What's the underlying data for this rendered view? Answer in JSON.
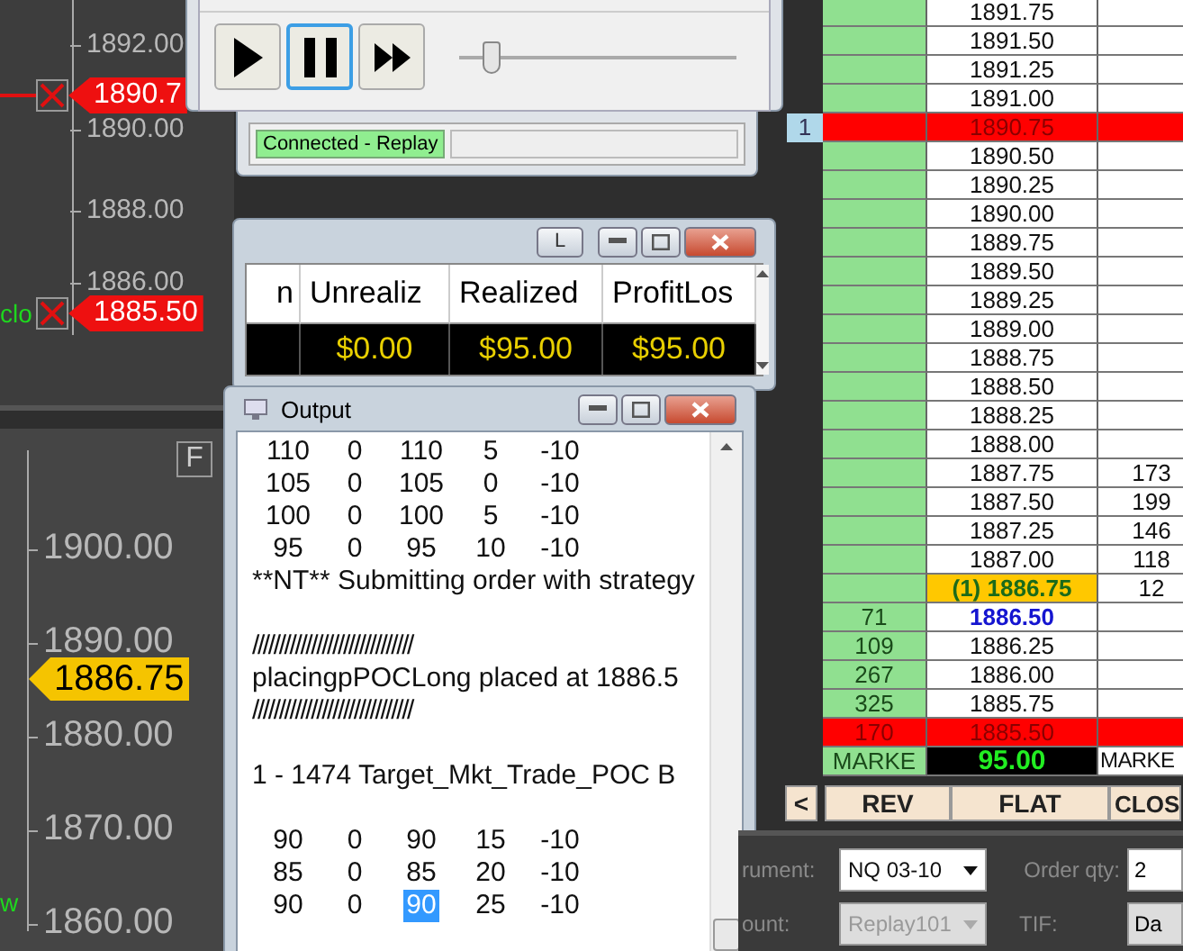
{
  "chart_top": {
    "ticks": [
      "1892.00",
      "1890.00",
      "1888.00",
      "1886.00"
    ],
    "orders": [
      {
        "price": "1890.7"
      },
      {
        "price": "1885.50",
        "note": "clo"
      }
    ]
  },
  "chart_bottom": {
    "button": "F",
    "ticks": [
      "1900.00",
      "1890.00",
      "1880.00",
      "1870.00",
      "1860.00"
    ],
    "last_price": "1886.75",
    "note": "w"
  },
  "replay": {
    "buttons": [
      {
        "kind": "play",
        "selected": false
      },
      {
        "kind": "pause",
        "selected": true
      },
      {
        "kind": "fast_forward",
        "selected": false
      }
    ],
    "speed": {
      "level": 0.12
    }
  },
  "connection": {
    "status": "Connected - Replay"
  },
  "positions": {
    "title_button": "L",
    "columns": [
      "n",
      "Unrealiz",
      "Realized",
      "ProfitLos"
    ],
    "row": [
      "$0.00",
      "$95.00",
      "$95.00"
    ]
  },
  "output": {
    "title": "Output",
    "lines": [
      {
        "kind": "row",
        "cells": [
          {
            "text": "110",
            "selected": false
          },
          {
            "text": "0",
            "selected": false
          },
          {
            "text": "110",
            "selected": false
          },
          {
            "text": "5",
            "selected": false
          },
          {
            "text": "-10",
            "selected": false
          }
        ]
      },
      {
        "kind": "row",
        "cells": [
          {
            "text": "105",
            "selected": false
          },
          {
            "text": "0",
            "selected": false
          },
          {
            "text": "105",
            "selected": false
          },
          {
            "text": "0",
            "selected": false
          },
          {
            "text": "-10",
            "selected": false
          }
        ]
      },
      {
        "kind": "row",
        "cells": [
          {
            "text": "100",
            "selected": false
          },
          {
            "text": "0",
            "selected": false
          },
          {
            "text": "100",
            "selected": false
          },
          {
            "text": "5",
            "selected": false
          },
          {
            "text": "-10",
            "selected": false
          }
        ]
      },
      {
        "kind": "row",
        "cells": [
          {
            "text": "95",
            "selected": false
          },
          {
            "text": "0",
            "selected": false
          },
          {
            "text": "95",
            "selected": false
          },
          {
            "text": "10",
            "selected": false
          },
          {
            "text": "-10",
            "selected": false
          }
        ]
      },
      {
        "kind": "text",
        "text": "**NT** Submitting order with strategy"
      },
      {
        "kind": "blank"
      },
      {
        "kind": "text",
        "text": "//////////////////////////////"
      },
      {
        "kind": "text",
        "text": "placingpPOCLong placed at 1886.5"
      },
      {
        "kind": "text",
        "text": "//////////////////////////////"
      },
      {
        "kind": "blank"
      },
      {
        "kind": "text",
        "text": "1 - 1474 Target_Mkt_Trade_POC  B"
      },
      {
        "kind": "blank"
      },
      {
        "kind": "row",
        "cells": [
          {
            "text": "90",
            "selected": false
          },
          {
            "text": "0",
            "selected": false
          },
          {
            "text": "90",
            "selected": false
          },
          {
            "text": "15",
            "selected": false
          },
          {
            "text": "-10",
            "selected": false
          }
        ]
      },
      {
        "kind": "row",
        "cells": [
          {
            "text": "85",
            "selected": false
          },
          {
            "text": "0",
            "selected": false
          },
          {
            "text": "85",
            "selected": false
          },
          {
            "text": "20",
            "selected": false
          },
          {
            "text": "-10",
            "selected": false
          }
        ]
      },
      {
        "kind": "row",
        "cells": [
          {
            "text": "90",
            "selected": false
          },
          {
            "text": "0",
            "selected": false
          },
          {
            "text": "90",
            "selected": true
          },
          {
            "text": "25",
            "selected": false
          },
          {
            "text": "-10",
            "selected": false
          }
        ]
      }
    ]
  },
  "dom": {
    "rows": [
      {
        "kind": "plain",
        "price": "1891.75"
      },
      {
        "kind": "plain",
        "price": "1891.50"
      },
      {
        "kind": "plain",
        "price": "1891.25"
      },
      {
        "kind": "plain",
        "price": "1891.00"
      },
      {
        "kind": "order",
        "price": "1890.75",
        "marker": "1"
      },
      {
        "kind": "plain",
        "price": "1890.50"
      },
      {
        "kind": "plain",
        "price": "1890.25"
      },
      {
        "kind": "plain",
        "price": "1890.00"
      },
      {
        "kind": "plain",
        "price": "1889.75"
      },
      {
        "kind": "plain",
        "price": "1889.50"
      },
      {
        "kind": "plain",
        "price": "1889.25"
      },
      {
        "kind": "plain",
        "price": "1889.00"
      },
      {
        "kind": "plain",
        "price": "1888.75"
      },
      {
        "kind": "plain",
        "price": "1888.50"
      },
      {
        "kind": "plain",
        "price": "1888.25"
      },
      {
        "kind": "plain",
        "price": "1888.00"
      },
      {
        "kind": "plain",
        "price": "1887.75",
        "ask": "173"
      },
      {
        "kind": "plain",
        "price": "1887.50",
        "ask": "199"
      },
      {
        "kind": "plain",
        "price": "1887.25",
        "ask": "146"
      },
      {
        "kind": "plain",
        "price": "1887.00",
        "ask": "118"
      },
      {
        "kind": "position",
        "price": "(1) 1886.75",
        "ask": "12"
      },
      {
        "kind": "last",
        "price": "1886.50",
        "bid": "71"
      },
      {
        "kind": "plain",
        "price": "1886.25",
        "bid": "109"
      },
      {
        "kind": "plain",
        "price": "1886.00",
        "bid": "267"
      },
      {
        "kind": "plain",
        "price": "1885.75",
        "bid": "325"
      },
      {
        "kind": "order",
        "price": "1885.50",
        "bid": "170"
      }
    ],
    "market_row": {
      "bid": "MARKE",
      "price": "95.00",
      "ask": "MARKE"
    },
    "buttons": [
      "<",
      "REV",
      "FLAT",
      "CLOS"
    ]
  },
  "order_panel": {
    "instrument": {
      "label": "rument:",
      "value": "NQ 03-10",
      "disabled": false
    },
    "account": {
      "label": "ount:",
      "value": "Replay101",
      "disabled": true
    },
    "qty": {
      "label": "Order qty:",
      "value": "2"
    },
    "tif": {
      "label": "TIF:",
      "value": "Da"
    }
  }
}
